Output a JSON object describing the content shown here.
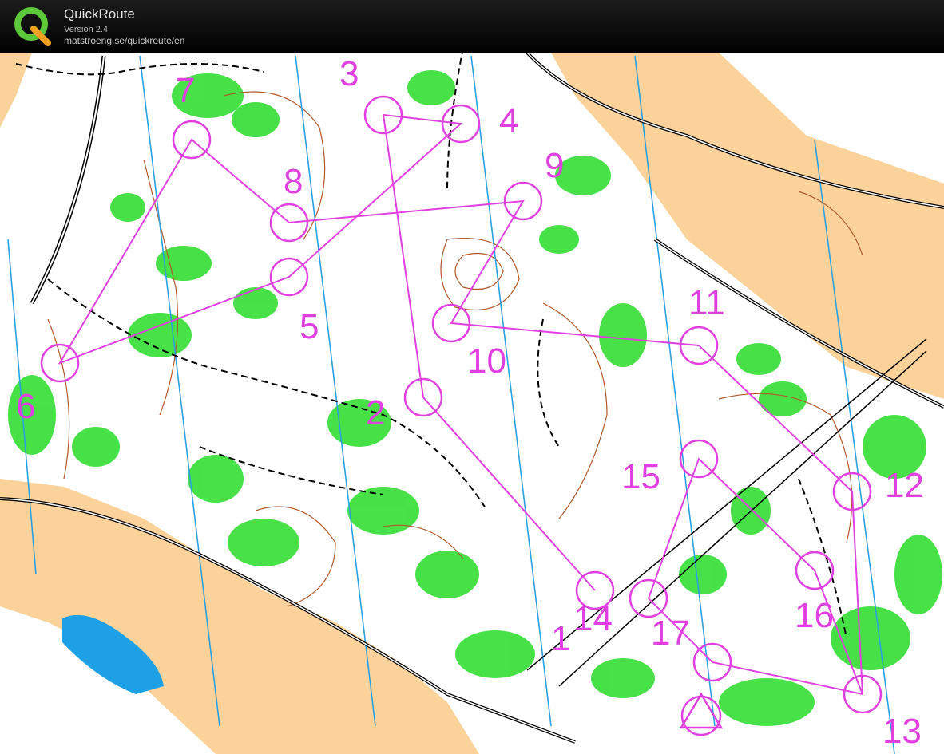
{
  "app": {
    "title": "QuickRoute",
    "version": "Version 2.4",
    "url": "matstroeng.se/quickroute/en"
  },
  "colors": {
    "course": "#e040e0",
    "vegetation": "#3ee03e",
    "open_land": "#fbd29a",
    "contour": "#b0582a",
    "water": "#1ea0e6",
    "magnetic_north": "#2aa0e0"
  },
  "course": {
    "controls": [
      {
        "label": "1"
      },
      {
        "label": "2"
      },
      {
        "label": "3"
      },
      {
        "label": "4"
      },
      {
        "label": "5"
      },
      {
        "label": "6"
      },
      {
        "label": "7"
      },
      {
        "label": "8"
      },
      {
        "label": "9"
      },
      {
        "label": "10"
      },
      {
        "label": "11"
      },
      {
        "label": "12"
      },
      {
        "label": "13"
      },
      {
        "label": "14"
      },
      {
        "label": "15"
      },
      {
        "label": "16"
      },
      {
        "label": "17"
      }
    ]
  }
}
